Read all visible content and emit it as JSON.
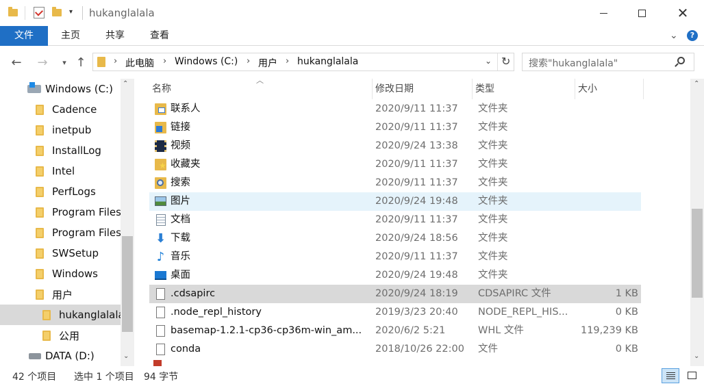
{
  "window": {
    "title": "hukanglalala",
    "controls": [
      "minimize",
      "maximize",
      "close"
    ]
  },
  "ribbon": {
    "tabs": [
      "文件",
      "主页",
      "共享",
      "查看"
    ]
  },
  "address": {
    "path": [
      "此电脑",
      "Windows (C:)",
      "用户",
      "hukanglalala"
    ],
    "search_placeholder": "搜索\"hukanglalala\""
  },
  "nav_tree": [
    {
      "label": "Windows (C:)",
      "level": 0,
      "icon": "drive-icon"
    },
    {
      "label": "Cadence",
      "level": 1,
      "icon": "folder-icon"
    },
    {
      "label": "inetpub",
      "level": 1,
      "icon": "folder-icon"
    },
    {
      "label": "InstallLog",
      "level": 1,
      "icon": "folder-icon"
    },
    {
      "label": "Intel",
      "level": 1,
      "icon": "folder-icon"
    },
    {
      "label": "PerfLogs",
      "level": 1,
      "icon": "folder-icon"
    },
    {
      "label": "Program Files",
      "level": 1,
      "icon": "folder-icon"
    },
    {
      "label": "Program Files",
      "level": 1,
      "icon": "folder-icon"
    },
    {
      "label": "SWSetup",
      "level": 1,
      "icon": "folder-icon"
    },
    {
      "label": "Windows",
      "level": 1,
      "icon": "folder-icon"
    },
    {
      "label": "用户",
      "level": 1,
      "icon": "folder-icon"
    },
    {
      "label": "hukanglalala",
      "level": 2,
      "icon": "folder-icon",
      "selected": true
    },
    {
      "label": "公用",
      "level": 2,
      "icon": "folder-icon"
    },
    {
      "label": "DATA (D:)",
      "level": 0,
      "icon": "drive-icon"
    }
  ],
  "columns": [
    "名称",
    "修改日期",
    "类型",
    "大小"
  ],
  "files": [
    {
      "name": "联系人",
      "date": "2020/9/11 11:37",
      "type": "文件夹",
      "size": "",
      "icon": "contacts-icon"
    },
    {
      "name": "链接",
      "date": "2020/9/11 11:37",
      "type": "文件夹",
      "size": "",
      "icon": "links-icon"
    },
    {
      "name": "视频",
      "date": "2020/9/24 13:38",
      "type": "文件夹",
      "size": "",
      "icon": "video-icon"
    },
    {
      "name": "收藏夹",
      "date": "2020/9/11 11:37",
      "type": "文件夹",
      "size": "",
      "icon": "favorites-icon"
    },
    {
      "name": "搜索",
      "date": "2020/9/11 11:37",
      "type": "文件夹",
      "size": "",
      "icon": "search-folder-icon"
    },
    {
      "name": "图片",
      "date": "2020/9/24 19:48",
      "type": "文件夹",
      "size": "",
      "icon": "pictures-icon",
      "state": "hover"
    },
    {
      "name": "文档",
      "date": "2020/9/11 11:37",
      "type": "文件夹",
      "size": "",
      "icon": "documents-icon"
    },
    {
      "name": "下载",
      "date": "2020/9/24 18:56",
      "type": "文件夹",
      "size": "",
      "icon": "downloads-icon"
    },
    {
      "name": "音乐",
      "date": "2020/9/11 11:37",
      "type": "文件夹",
      "size": "",
      "icon": "music-icon"
    },
    {
      "name": "桌面",
      "date": "2020/9/24 19:48",
      "type": "文件夹",
      "size": "",
      "icon": "desktop-icon"
    },
    {
      "name": ".cdsapirc",
      "date": "2020/9/24 18:19",
      "type": "CDSAPIRC 文件",
      "size": "1 KB",
      "icon": "file-icon",
      "state": "selected"
    },
    {
      "name": ".node_repl_history",
      "date": "2019/3/23 20:40",
      "type": "NODE_REPL_HIS...",
      "size": "0 KB",
      "icon": "file-icon"
    },
    {
      "name": "basemap-1.2.1-cp36-cp36m-win_am...",
      "date": "2020/6/2 5:21",
      "type": "WHL 文件",
      "size": "119,239 KB",
      "icon": "file-icon"
    },
    {
      "name": "conda",
      "date": "2018/10/26 22:00",
      "type": "文件",
      "size": "0 KB",
      "icon": "file-icon"
    }
  ],
  "status": {
    "count": "42 个项目",
    "selection": "选中 1 个项目",
    "selection_size": "94 字节"
  },
  "colors": {
    "accent": "#1f6fc5",
    "hover_row": "#e5f3fb",
    "selected_row": "#d9d9d9",
    "folder": "#e8b94a"
  }
}
